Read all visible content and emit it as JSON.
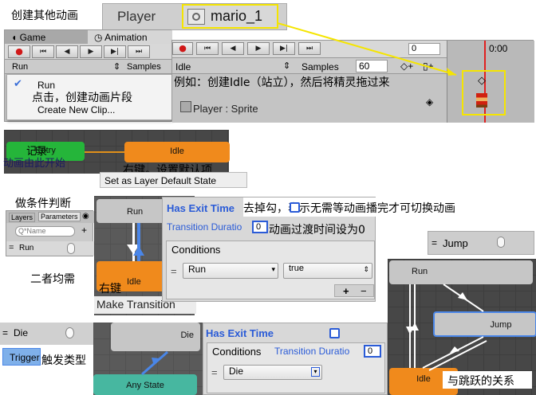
{
  "annotations": {
    "create_other": "创建其他动画",
    "click_create": "点击，创建动画片段",
    "example": "例如：创建Idle（站立），然后将精灵拖过来",
    "record": "记录",
    "start_here": "动画由此开始",
    "right_click_default": "右键。设置默认项",
    "conditions_judge": "做条件判断",
    "uncheck": "去掉勾，表示无需等动画播完才可切换动画",
    "transition_zero": "动画过渡时间设为0",
    "both_needed": "二者均需",
    "right_click": "右键",
    "trigger_type": "触发类型",
    "jump_relation": "与跳跃的关系"
  },
  "header": {
    "object_name": "Player",
    "clip_name": "mario_1"
  },
  "tabs": {
    "game": "Game",
    "animation": "Animation"
  },
  "animation_panel": {
    "frame_value": "0",
    "clip_select": "Run",
    "samples_label": "Samples",
    "clip_select_2": "Idle",
    "samples_label_2": "Samples",
    "samples_value": "60",
    "time_label": "0:00",
    "track_label": "Player : Sprite",
    "menu_items": [
      "Run",
      "Create New Clip..."
    ]
  },
  "state_graph_top": {
    "entry": "Entry",
    "idle": "Idle",
    "context_item": "Set as Layer Default State"
  },
  "parameters_panel": {
    "tab_layers": "Layers",
    "tab_parameters": "Parameters",
    "search_placeholder": "Q*Name",
    "param_name": "Run",
    "add_symbol": "+"
  },
  "transition_graph": {
    "run": "Run",
    "idle": "Idle",
    "menu_item": "Make Transition"
  },
  "transition_inspector": {
    "has_exit_time": "Has Exit Time",
    "transition_duration": "Transition Duratio",
    "duration_value": "0",
    "conditions_title": "Conditions",
    "condition_param": "Run",
    "condition_value": "true",
    "plus": "+",
    "minus": "−"
  },
  "jump_param": {
    "name": "Jump"
  },
  "die_panel": {
    "param_name": "Die",
    "trigger_label": "Trigger",
    "die_node": "Die",
    "any_state": "Any State"
  },
  "die_inspector": {
    "has_exit_time": "Has Exit Time",
    "conditions_title": "Conditions",
    "transition_duration": "Transition Duratio",
    "duration_value": "0",
    "condition_param": "Die"
  },
  "jump_graph": {
    "run": "Run",
    "jump": "Jump",
    "idle": "Idle"
  },
  "colors": {
    "highlight_yellow": "#f5e500",
    "playhead_red": "#e02020",
    "entry_green": "#25b53a",
    "state_orange": "#f08a1c",
    "selected_blue": "#4a86e8"
  }
}
